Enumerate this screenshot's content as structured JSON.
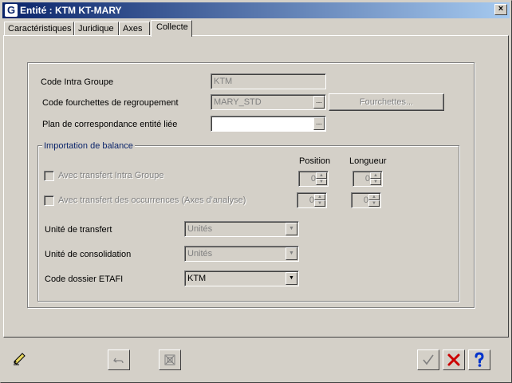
{
  "window": {
    "title": "Entité : KTM KT-MARY",
    "app_icon": "G",
    "close_glyph": "×"
  },
  "tabs": [
    {
      "label": "Caractéristiques"
    },
    {
      "label": "Juridique"
    },
    {
      "label": "Axes"
    },
    {
      "label": "Collecte",
      "active": true
    }
  ],
  "form": {
    "code_intra_groupe": {
      "label": "Code Intra Groupe",
      "value": "KTM"
    },
    "code_fourchettes": {
      "label": "Code fourchettes de regroupement",
      "value": "MARY_STD"
    },
    "fourchettes_button": "Fourchettes...",
    "plan_correspondance": {
      "label": "Plan de correspondance entité liée",
      "value": ""
    },
    "ellipsis": "..."
  },
  "import": {
    "title": "Importation de balance",
    "col_position": "Position",
    "col_longueur": "Longueur",
    "rows": [
      {
        "label": "Avec transfert Intra Groupe",
        "position": "0",
        "longueur": "0"
      },
      {
        "label": "Avec transfert des occurrences (Axes d'analyse)",
        "position": "0",
        "longueur": "0"
      }
    ],
    "unite_transfert": {
      "label": "Unité de transfert",
      "value": "Unités"
    },
    "unite_consolidation": {
      "label": "Unité de consolidation",
      "value": "Unités"
    },
    "code_dossier": {
      "label": "Code dossier ETAFI",
      "value": "KTM"
    }
  },
  "glyphs": {
    "spin_up": "▲",
    "spin_down": "▼",
    "dropdown": "▼"
  },
  "colors": {
    "title_start": "#0a246a",
    "title_end": "#a6caf0",
    "cancel_red": "#cc0000",
    "help_blue": "#0033cc"
  }
}
